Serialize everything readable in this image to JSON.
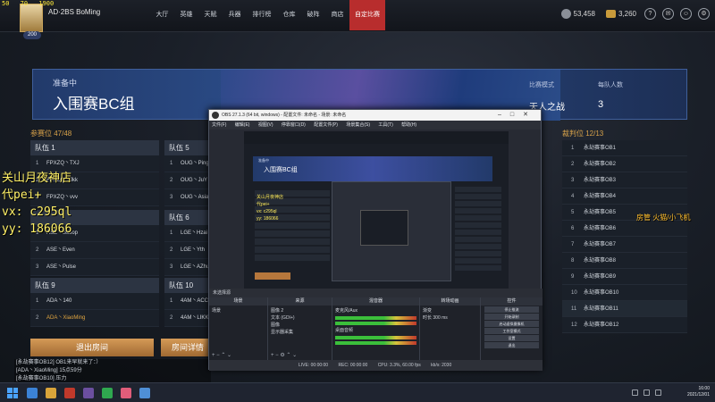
{
  "hud": {
    "fps_values": [
      "50",
      "70",
      "1900"
    ],
    "player_name": "AD·2BS BoMing",
    "player_level": "200"
  },
  "nav": {
    "items": [
      "大厅",
      "英雄",
      "天赋",
      "兵器",
      "排行榜",
      "仓库",
      "破阵",
      "商店",
      "自定比赛"
    ],
    "active_index": 8,
    "active_color": "#b82d2d"
  },
  "currency": {
    "silver": "53,458",
    "gold": "3,260"
  },
  "top_icons": [
    "help-icon",
    "mail-icon",
    "friends-icon",
    "settings-icon"
  ],
  "banner": {
    "status": "准备中",
    "title": "入围赛BC组",
    "mode_label": "比赛模式",
    "mode_value": "天人之战",
    "per_team_label": "每队人数",
    "per_team_value": "3"
  },
  "teams": {
    "seat_count": "参赛位 47/48",
    "list": [
      {
        "name": "队伍 1",
        "members": [
          {
            "n": "1",
            "p": "FPXZQ丶TXJ"
          },
          {
            "n": "2",
            "p": "FPXZQ丶Jkk"
          },
          {
            "n": "3",
            "p": "FPXZQ丶vvv"
          }
        ]
      },
      {
        "name": "队伍 5",
        "members": [
          {
            "n": "1",
            "p": "OUG丶Ping"
          },
          {
            "n": "2",
            "p": "OUG丶JuY"
          },
          {
            "n": "3",
            "p": "OUG丶Asia"
          }
        ]
      },
      {
        "name": "",
        "members": [
          {
            "n": "1",
            "p": "ASE丶Ssoop"
          },
          {
            "n": "2",
            "p": "ASE丶Even"
          },
          {
            "n": "3",
            "p": "ASE丶Pulse"
          }
        ]
      },
      {
        "name": "队伍 6",
        "members": [
          {
            "n": "1",
            "p": "LGE丶Hzai"
          },
          {
            "n": "2",
            "p": "LGE丶Yth"
          },
          {
            "n": "3",
            "p": "LGE丶AZhu"
          }
        ]
      },
      {
        "name": "队伍 9",
        "members": [
          {
            "n": "1",
            "p": "ADA丶140"
          },
          {
            "n": "2",
            "p": "ADA丶XiaoMing"
          }
        ]
      },
      {
        "name": "队伍 10",
        "members": [
          {
            "n": "1",
            "p": "4AM丶ACC"
          },
          {
            "n": "2",
            "p": "4AM丶LIKK"
          }
        ]
      }
    ]
  },
  "referees": {
    "count": "裁判位 12/13",
    "rows": [
      {
        "n": "1",
        "p": "永劫赛事OB1"
      },
      {
        "n": "2",
        "p": "永劫赛事OB2"
      },
      {
        "n": "3",
        "p": "永劫赛事OB3"
      },
      {
        "n": "4",
        "p": "永劫赛事OB4"
      },
      {
        "n": "5",
        "p": "永劫赛事OB5"
      },
      {
        "n": "6",
        "p": "永劫赛事OB6"
      },
      {
        "n": "7",
        "p": "永劫赛事OB7"
      },
      {
        "n": "8",
        "p": "永劫赛事OB8"
      },
      {
        "n": "9",
        "p": "永劫赛事OB9"
      },
      {
        "n": "10",
        "p": "永劫赛事OB10"
      },
      {
        "n": "11",
        "p": "永劫赛事OB11"
      },
      {
        "n": "12",
        "p": "永劫赛事OB12"
      }
    ]
  },
  "buttons": {
    "leave": "退出房间",
    "details": "房间详情"
  },
  "chat": [
    "[永劫赛事OB12] OB1来早就来了：）",
    "[ADA丶XiaoMing] 15点59分",
    "[永劫赛事OB10] 压力"
  ],
  "streamer": {
    "lines": [
      "关山月夜神店",
      "代pei+",
      "vx: c295ql",
      "yy: 186066"
    ],
    "tag": "房管 火猫/小飞机"
  },
  "obs": {
    "title": "OBS 27.1.3 (64 bit, windows) - 配置文件: 未命名 - 场景: 未命名",
    "menu": [
      "文件(F)",
      "编辑(E)",
      "视图(V)",
      "停靠窗口(D)",
      "配置文件(P)",
      "场景集合(S)",
      "工具(T)",
      "帮助(H)"
    ],
    "scene_bar": "未选择源",
    "preview_title": "入围赛BC组",
    "preview_status": "准备中",
    "docks": {
      "scenes_title": "场景",
      "scenes": [
        "场景"
      ],
      "sources_title": "来源",
      "sources": [
        "图像 2",
        "文本 (GDI+)",
        "图像",
        "显示器采集"
      ],
      "mixer_title": "混音器",
      "mixer": [
        "麦克风/Aux",
        "桌面音频"
      ],
      "transitions_title": "转场动画",
      "transition_value": "渐变",
      "duration_label": "时长",
      "duration_value": "300 ms",
      "controls_title": "控件",
      "controls": [
        "停止推流",
        "开始录制",
        "启动虚拟摄像机",
        "工作室模式",
        "设置",
        "退出"
      ]
    },
    "status": [
      "LIVE: 00:00:00",
      "REC: 00:00:00",
      "CPU: 3.3%, 60.00 fps",
      "kb/s: 2030"
    ]
  },
  "taskbar": {
    "time": "16:00",
    "date": "2021/12/01"
  }
}
